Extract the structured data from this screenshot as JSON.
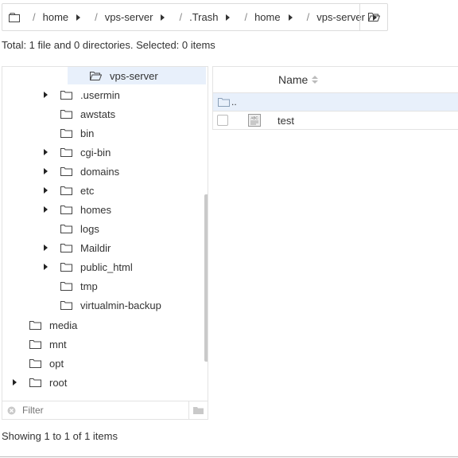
{
  "breadcrumb": {
    "segments": [
      "home",
      "vps-server",
      ".Trash",
      "home",
      "vps-server"
    ]
  },
  "summary": {
    "total_text": "Total: 1 file and 0 directories. Selected: 0 items",
    "showing_text": "Showing 1 to 1 of 1 items"
  },
  "tree": {
    "selected": "vps-server",
    "items": [
      {
        "label": ".usermin",
        "expandable": true
      },
      {
        "label": "awstats",
        "expandable": false
      },
      {
        "label": "bin",
        "expandable": false
      },
      {
        "label": "cgi-bin",
        "expandable": true
      },
      {
        "label": "domains",
        "expandable": true
      },
      {
        "label": "etc",
        "expandable": true
      },
      {
        "label": "homes",
        "expandable": true
      },
      {
        "label": "logs",
        "expandable": false
      },
      {
        "label": "Maildir",
        "expandable": true
      },
      {
        "label": "public_html",
        "expandable": true
      },
      {
        "label": "tmp",
        "expandable": false
      },
      {
        "label": "virtualmin-backup",
        "expandable": false
      }
    ],
    "root_items": [
      {
        "label": "media",
        "expandable": false
      },
      {
        "label": "mnt",
        "expandable": false
      },
      {
        "label": "opt",
        "expandable": false
      },
      {
        "label": "root",
        "expandable": true
      }
    ],
    "filter_placeholder": "Filter"
  },
  "filelist": {
    "name_header": "Name",
    "parent_label": "..",
    "files": [
      {
        "name": "test",
        "icon": "text-file-icon"
      }
    ]
  },
  "colors": {
    "selection": "#e8f0fb",
    "border": "#e3e3e3",
    "text": "#333333"
  }
}
